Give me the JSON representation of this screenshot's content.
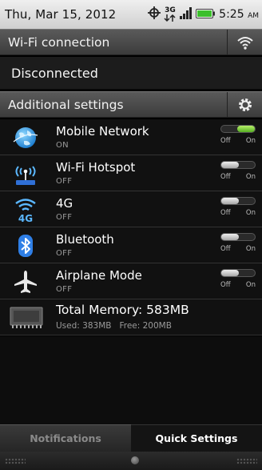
{
  "status_bar": {
    "date": "Thu, Mar 15, 2012",
    "network_type": "3G",
    "time": "5:25",
    "ampm": "AM"
  },
  "wifi_section": {
    "title": "Wi-Fi connection",
    "status": "Disconnected",
    "icon": "wifi-icon"
  },
  "additional_section": {
    "title": "Additional settings",
    "icon": "gear-icon"
  },
  "settings": [
    {
      "label": "Mobile Network",
      "status": "ON",
      "icon": "globe-icon",
      "on": true,
      "off_label": "Off",
      "on_label": "On"
    },
    {
      "label": "Wi-Fi Hotspot",
      "status": "OFF",
      "icon": "hotspot-icon",
      "on": false,
      "off_label": "Off",
      "on_label": "On"
    },
    {
      "label": "4G",
      "status": "OFF",
      "icon": "4g-icon",
      "on": false,
      "off_label": "Off",
      "on_label": "On"
    },
    {
      "label": "Bluetooth",
      "status": "OFF",
      "icon": "bluetooth-icon",
      "on": false,
      "off_label": "Off",
      "on_label": "On"
    },
    {
      "label": "Airplane Mode",
      "status": "OFF",
      "icon": "airplane-icon",
      "on": false,
      "off_label": "Off",
      "on_label": "On"
    }
  ],
  "memory": {
    "title": "Total Memory: 583MB",
    "detail": "Used: 383MB   Free: 200MB",
    "icon": "memory-chip-icon"
  },
  "tabs": {
    "notifications": "Notifications",
    "quick_settings": "Quick Settings",
    "active": "quick_settings"
  },
  "colors": {
    "toggle_on": "#66bb22",
    "header_bg": "#4a4a4a",
    "status_bar_bg": "#e2e2e2"
  }
}
